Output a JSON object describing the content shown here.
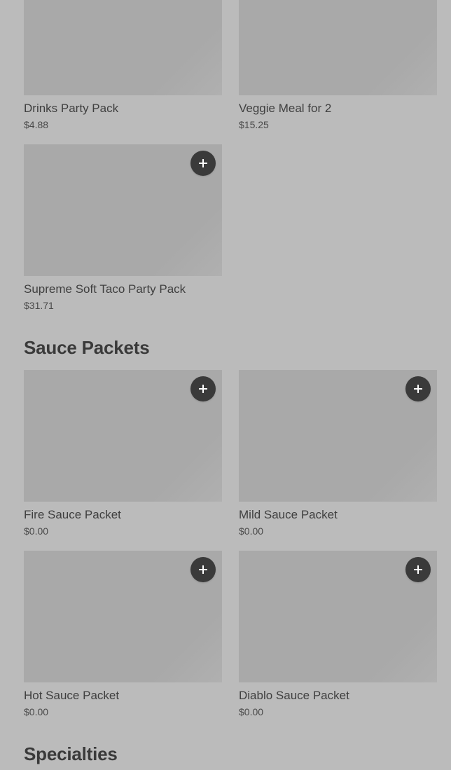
{
  "sections": {
    "party": {
      "items": [
        {
          "name": "Drinks Party Pack",
          "price": "$4.88"
        },
        {
          "name": "Veggie Meal for 2",
          "price": "$15.25"
        },
        {
          "name": "Supreme Soft Taco Party Pack",
          "price": "$31.71"
        }
      ]
    },
    "sauce": {
      "title": "Sauce Packets",
      "items": [
        {
          "name": "Fire Sauce Packet",
          "price": "$0.00"
        },
        {
          "name": "Mild Sauce Packet",
          "price": "$0.00"
        },
        {
          "name": "Hot Sauce Packet",
          "price": "$0.00"
        },
        {
          "name": "Diablo Sauce Packet",
          "price": "$0.00"
        }
      ]
    },
    "specialties": {
      "title": "Specialties"
    }
  },
  "icons": {
    "add": "plus-icon"
  },
  "colors": {
    "background": "#bbbbbb",
    "image_placeholder": "#a9a9a9",
    "add_button": "#3a3a3a",
    "text": "#3f3f3f"
  }
}
